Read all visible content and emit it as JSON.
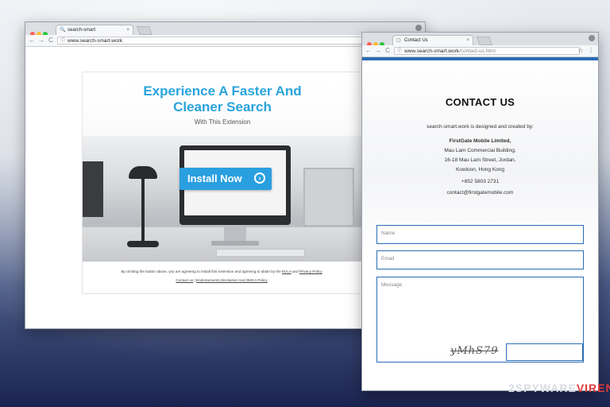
{
  "window1": {
    "tab_title": "search-smart",
    "tab_close": "×",
    "url": "www.search-smart.work",
    "nav": {
      "back": "←",
      "forward": "→",
      "reload": "C",
      "info": "ⓘ",
      "search_glyph": "🔍"
    },
    "banner": {
      "headline_line1": "Experience A Faster And",
      "headline_line2": "Cleaner Search",
      "subhead": "With This Extension",
      "install_label": "Install Now",
      "install_arrow": "›"
    },
    "disclaimer": {
      "text_before": "By clicking the button above, you are agreeing to install this extension and agreeing to abide by the ",
      "eula": "EULA",
      "and": " and ",
      "privacy": "Privacy Policy",
      "contact": "Contact us",
      "separator": " | ",
      "endorsements": "Endorsements Disclaimer And DMCA Policy"
    }
  },
  "window2": {
    "tab_title": "Contact Us",
    "tab_close": "×",
    "url_host": "www.search-smart.work",
    "url_path": "/contact-us.html",
    "nav": {
      "back": "←",
      "forward": "→",
      "reload": "C",
      "info": "ⓘ",
      "star": "☆",
      "menu": "⋮",
      "tab_glyph": "▢"
    },
    "title": "CONTACT US",
    "intro": "search-smart.work is designed and created by:",
    "company": "FirstGate Mobile Limited,",
    "address1": "Mau Lam Commercial Building,",
    "address2": "16-18 Mau Lam Street, Jordan,",
    "address3": "Kowloon, Hong Kong",
    "phone": "+852 5803 2731",
    "email": "contact@firstgatemobile.com",
    "form": {
      "name_placeholder": "Name",
      "email_placeholder": "Email",
      "message_placeholder": "Message",
      "captcha_text": "yMhS79"
    }
  },
  "watermark": {
    "part1": "2SPYWARE",
    "part2": "VIREN"
  },
  "colors": {
    "accent_blue": "#2aa3dd",
    "button_blue": "#2a9fe0",
    "form_border": "#2a6db5"
  }
}
